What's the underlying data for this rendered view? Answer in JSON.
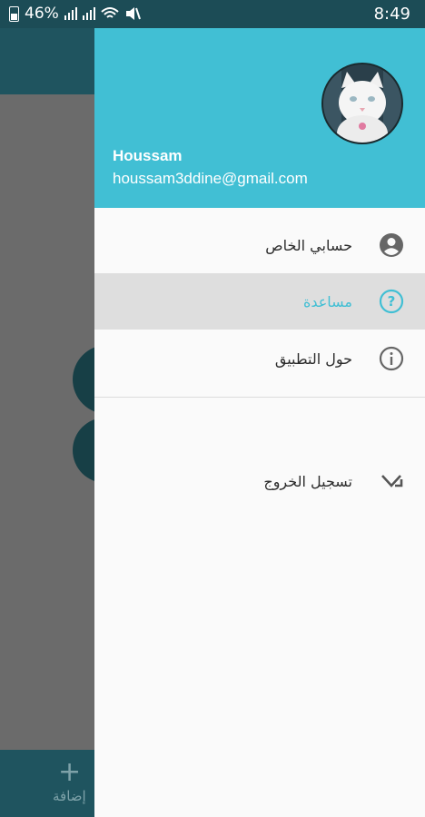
{
  "status_bar": {
    "battery": "46%",
    "time": "8:49"
  },
  "background_app": {
    "add_icon": "+",
    "add_label": "إضافة"
  },
  "drawer": {
    "header": {
      "name": "Houssam",
      "email": "houssam3ddine@gmail.com",
      "avatar_icon": "cat-avatar"
    },
    "items": [
      {
        "label": "حسابي الخاص",
        "icon": "account-circle-icon",
        "active": false
      },
      {
        "label": "مساعدة",
        "icon": "help-icon",
        "active": true
      },
      {
        "label": "حول التطبيق",
        "icon": "info-icon",
        "active": false
      }
    ],
    "logout": {
      "label": "تسجيل الخروج",
      "icon": "logout-arrow-icon"
    }
  },
  "colors": {
    "accent": "#41bfd4",
    "header_bg": "#41bfd4",
    "statusbar_bg": "#1c4c56",
    "active_item_bg": "#dedede",
    "scrim": "#6b6b6b"
  }
}
